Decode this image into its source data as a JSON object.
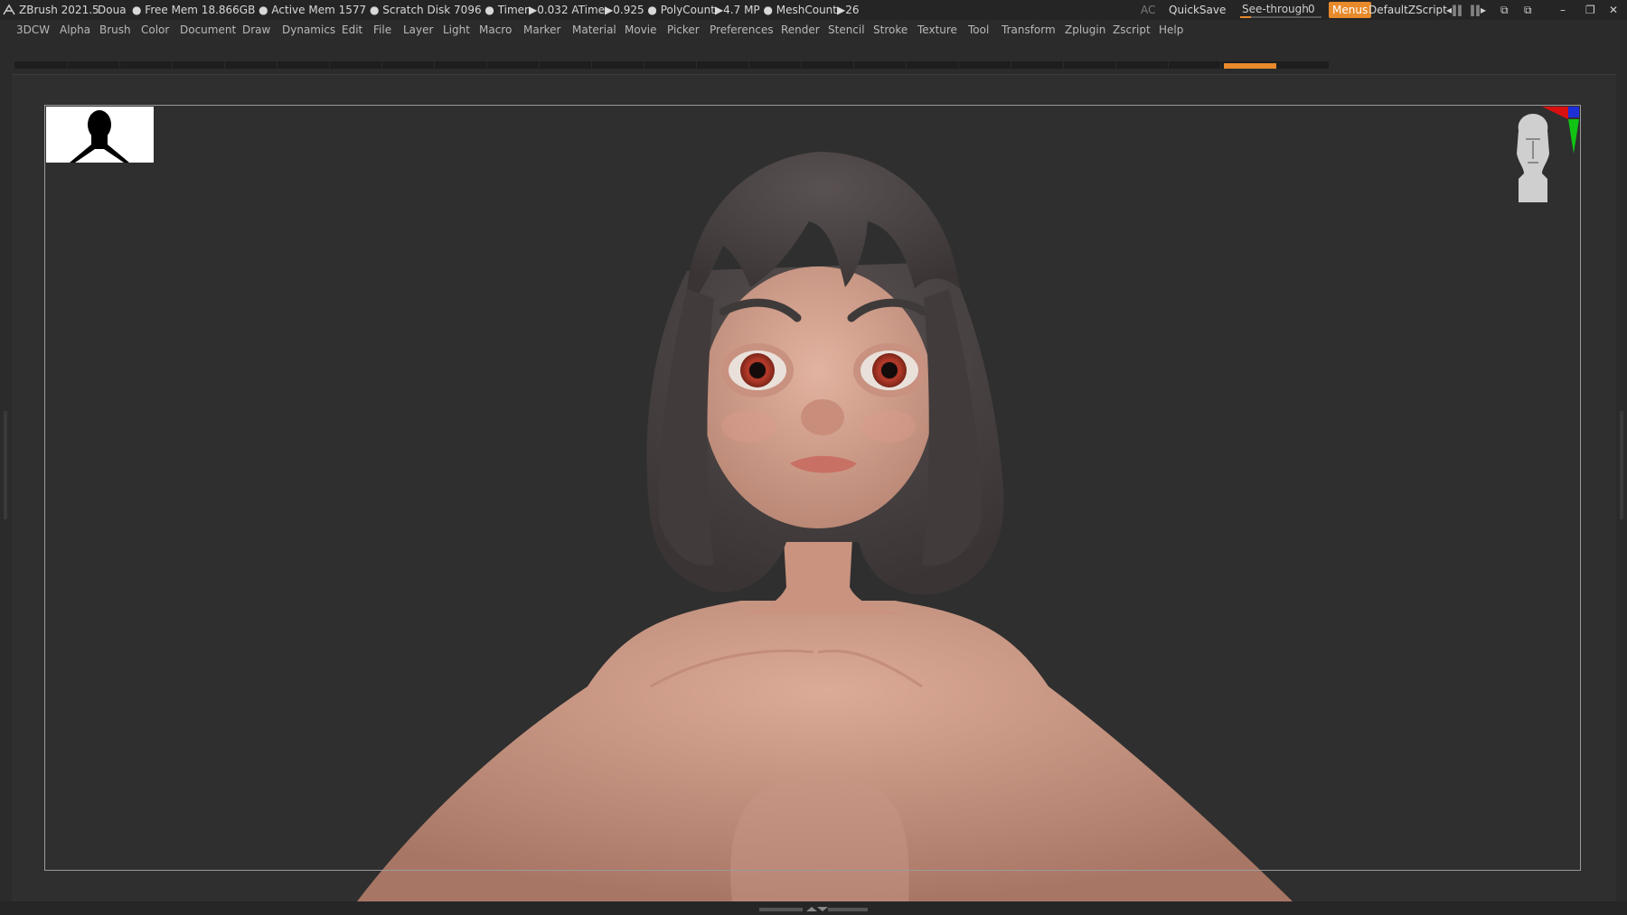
{
  "titlebar": {
    "app": "ZBrush 2021.5",
    "document": "Doua",
    "stats": "● Free Mem 18.866GB ● Active Mem 1577 ● Scratch Disk 7096 ● Timer▶0.032 ATime▶0.925 ● PolyCount▶4.7 MP ● MeshCount▶26",
    "ac": "AC",
    "quicksave": "QuickSave",
    "seethrough_label": "See-through",
    "seethrough_value": "0",
    "menus": "Menus",
    "script": "DefaultZScript"
  },
  "menubar": [
    "3DCW",
    "Alpha",
    "Brush",
    "Color",
    "Document",
    "Draw",
    "Dynamics",
    "Edit",
    "File",
    "Layer",
    "Light",
    "Macro",
    "Marker",
    "Material",
    "Movie",
    "Picker",
    "Preferences",
    "Render",
    "Stencil",
    "Stroke",
    "Texture",
    "Tool",
    "Transform",
    "Zplugin",
    "Zscript",
    "Help"
  ],
  "colors": {
    "accent": "#e88a2b",
    "background": "#2f2f2f",
    "skin": "#d9a794",
    "hair": "#4a4343",
    "iris": "#b33a2a"
  },
  "icons": [
    "zbrush-logo-icon",
    "window-minimize-icon",
    "window-restore-icon",
    "window-close-icon",
    "navigation-head-icon",
    "axis-gizmo-icon"
  ]
}
